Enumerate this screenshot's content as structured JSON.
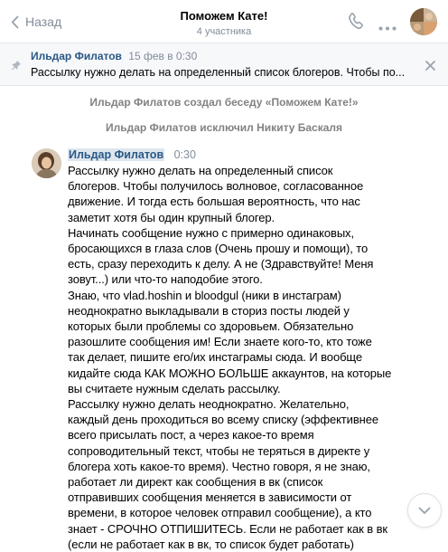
{
  "header": {
    "back_label": "Назад",
    "title": "Поможем Кате!",
    "subtitle": "4 участника"
  },
  "pinned": {
    "author": "Ильдар Филатов",
    "date": "15 фев в 0:30",
    "text": "Рассылку нужно делать на определенный список блогеров. Чтобы по..."
  },
  "service_messages": [
    "Ильдар Филатов создал беседу «Поможем Кате!»",
    "Ильдар Филатов исключил Никиту Баскаля"
  ],
  "message": {
    "author": "Ильдар Филатов",
    "time": "0:30",
    "lines": [
      "Рассылку нужно делать на определенный список",
      "блогеров. Чтобы получилось волновое, согласованное",
      "движение. И тогда есть большая вероятность, что нас",
      "заметит хотя бы один крупный блогер.",
      "Начинать сообщение нужно с примерно одинаковых,",
      "бросающихся в глаза слов (Очень прошу и помощи), то",
      "есть, сразу переходить к делу. А не (Здравствуйте! Меня",
      "зовут...) или что-то наподобие этого.",
      "Знаю, что vlad.hoshin и bloodgul (ники в инстаграм)",
      "неоднократно выкладывали в сториз посты людей у",
      "которых были проблемы со здоровьем. Обязательно",
      "разошлите сообщения им! Если знаете кого-то, кто тоже",
      "так делает, пишите его/их инстаграмы сюда. И вообще",
      "кидайте сюда КАК МОЖНО БОЛЬШЕ аккаунтов, на которые",
      "вы считаете нужным сделать рассылку.",
      "Рассылку нужно делать неоднократно. Желательно,",
      "каждый день проходиться во всему списку (эффективнее",
      "всего присылать пост, а через какое-то время",
      "сопроводительный текст, чтобы не теряться в директе у",
      "блогера хоть какое-то время). Честно говоря, я не знаю,",
      "работает ли директ как сообщения в вк (список",
      "отправивших сообщения меняется в зависимости от",
      "времени, в которое человек отправил сообщение), а кто",
      "знает - СРОЧНО ОТПИШИТЕСЬ. Если не работает как в вк",
      "(если не работает как в вк, то список будет работать)"
    ]
  },
  "icons": {
    "back": "chevron-left-icon",
    "call": "phone-icon",
    "more": "more-dots-icon",
    "pin": "pin-icon",
    "close": "close-icon",
    "scroll": "chevron-down-icon"
  },
  "colors": {
    "link": "#2a5885",
    "muted": "#818c99",
    "service": "#828282",
    "pinned_bg": "#f7f8fa"
  }
}
